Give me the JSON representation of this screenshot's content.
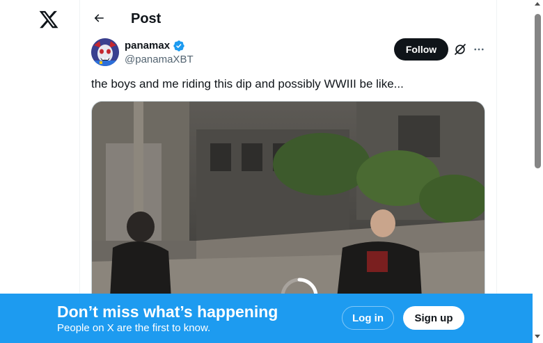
{
  "colors": {
    "brand_blue": "#1d9bf0",
    "text_primary": "#0f1419",
    "text_secondary": "#536471",
    "verified": "#1d9bf0"
  },
  "sidebar": {
    "logo_icon": "x-logo-icon"
  },
  "header": {
    "back_icon": "arrow-left-icon",
    "title": "Post"
  },
  "post": {
    "author_name": "panamax",
    "author_handle": "@panamaXBT",
    "verified_icon": "verified-badge-icon",
    "follow_label": "Follow",
    "grok_icon": "grok-icon",
    "more_icon": "more-horizontal-icon",
    "text": "the boys and me riding this dip and possibly WWIII be like...",
    "media": {
      "type": "video",
      "loading_icon": "loading-spinner-icon"
    }
  },
  "banner": {
    "title": "Don’t miss what’s happening",
    "subtitle": "People on X are the first to know.",
    "login_label": "Log in",
    "signup_label": "Sign up"
  }
}
